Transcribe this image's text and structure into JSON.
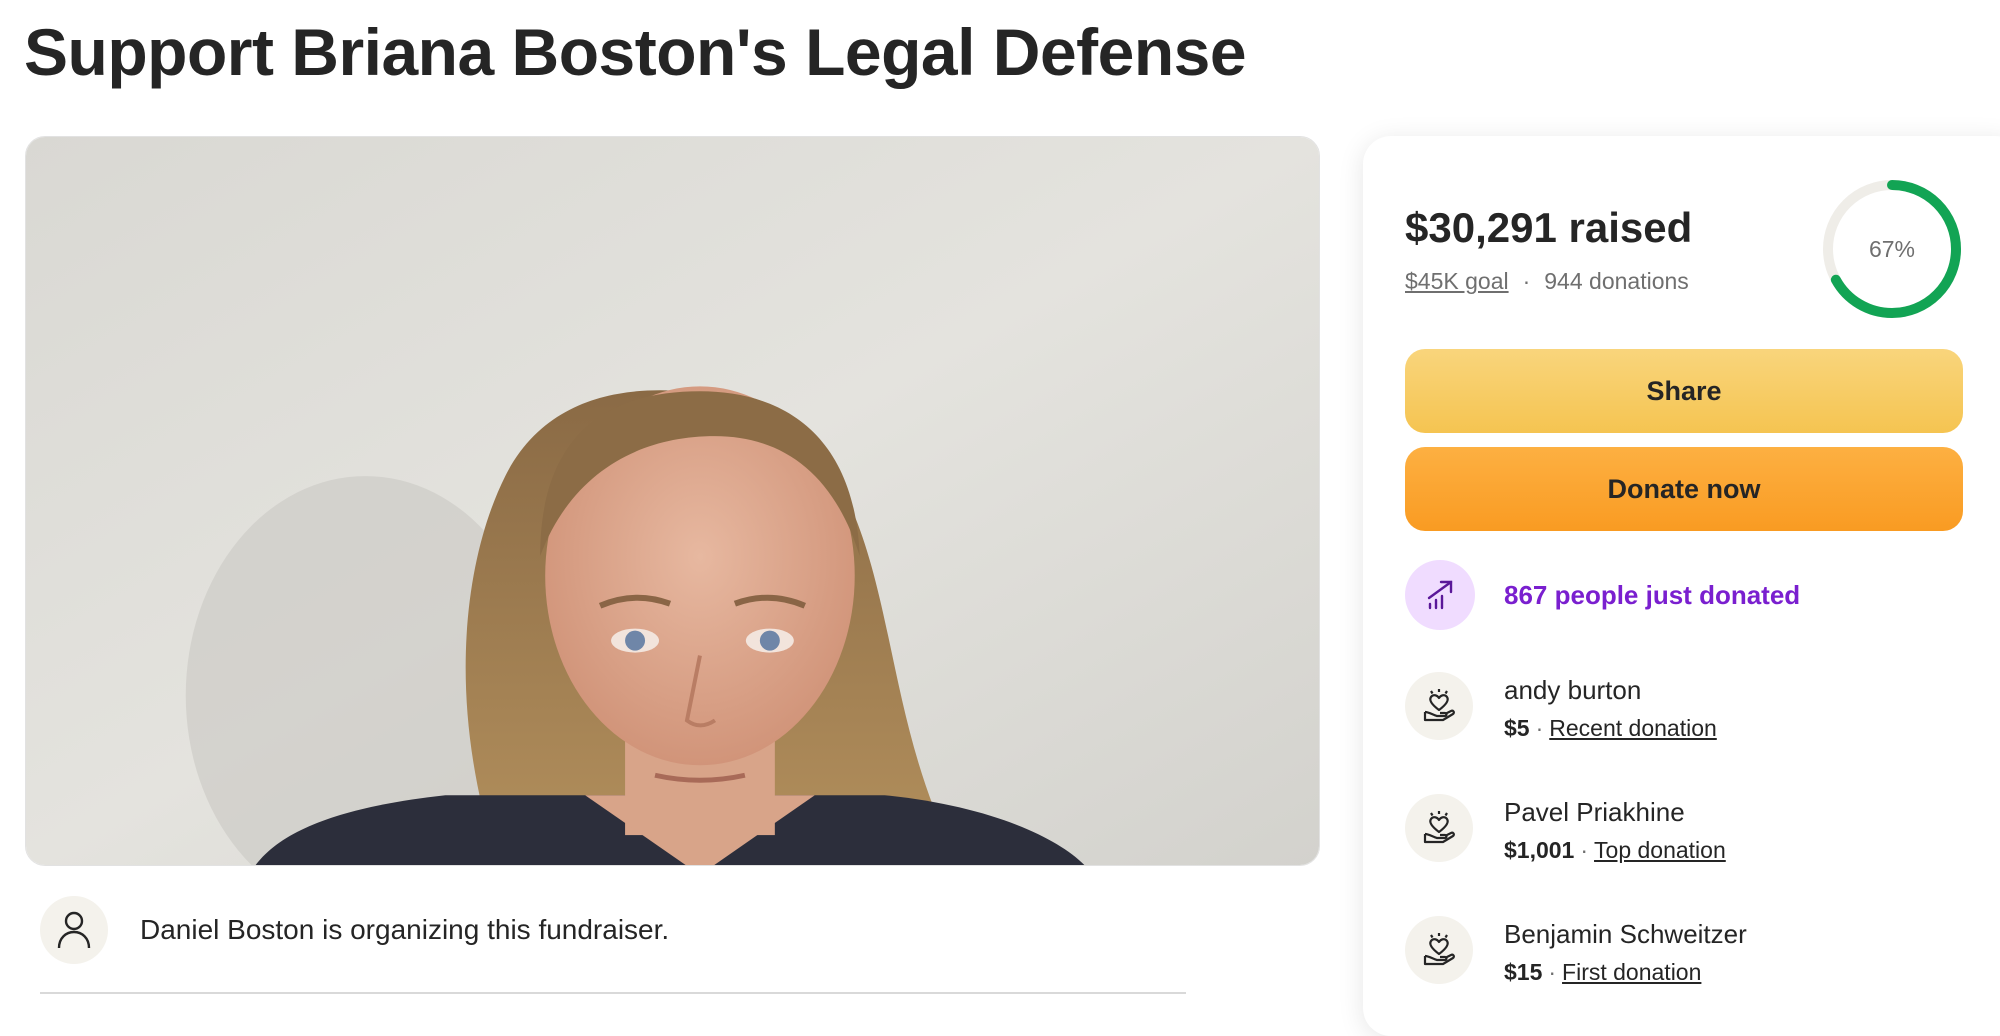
{
  "page": {
    "title": "Support Briana Boston's Legal Defense"
  },
  "organizer": {
    "text": "Daniel Boston is organizing this fundraiser.",
    "icon": "person-icon"
  },
  "progress": {
    "raised_label": "$30,291 raised",
    "goal_label": "$45K goal",
    "separator": "·",
    "donations_label": "944 donations",
    "percent_label": "67%",
    "percent_value": 67,
    "ring_color": "#12a454",
    "ring_track_color": "#efede8"
  },
  "buttons": {
    "share_label": "Share",
    "donate_label": "Donate now"
  },
  "activity": {
    "trend_label": "867 people just donated",
    "trend_icon": "trending-up-icon",
    "trend_color": "#7a1fcf"
  },
  "donations": [
    {
      "name": "andy burton",
      "amount": "$5",
      "separator": "·",
      "kind": "Recent donation"
    },
    {
      "name": "Pavel Priakhine",
      "amount": "$1,001",
      "separator": "·",
      "kind": "Top donation"
    },
    {
      "name": "Benjamin Schweitzer",
      "amount": "$15",
      "separator": "·",
      "kind": "First donation"
    }
  ]
}
